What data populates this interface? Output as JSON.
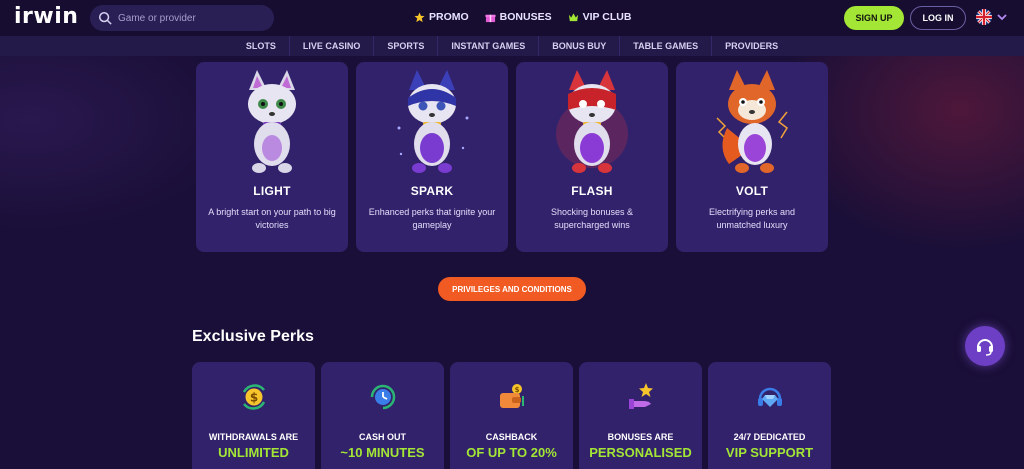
{
  "header": {
    "logo_text": "irwin",
    "search_placeholder": "Game or provider",
    "links": [
      {
        "label": "PROMO",
        "icon": "star-icon"
      },
      {
        "label": "BONUSES",
        "icon": "gift-icon"
      },
      {
        "label": "VIP CLUB",
        "icon": "crown-icon"
      }
    ],
    "signup_label": "SIGN UP",
    "login_label": "LOG IN",
    "language_icon": "uk-flag-icon"
  },
  "categories": [
    "SLOTS",
    "LIVE CASINO",
    "SPORTS",
    "INSTANT GAMES",
    "BONUS BUY",
    "TABLE GAMES",
    "PROVIDERS"
  ],
  "levels": [
    {
      "name": "LIGHT",
      "desc": "A bright start on your path to big victories",
      "color": "#d9d6e8"
    },
    {
      "name": "SPARK",
      "desc": "Enhanced perks that ignite your gameplay",
      "color": "#3b3fb8"
    },
    {
      "name": "FLASH",
      "desc": "Shocking bonuses & supercharged wins",
      "color": "#d8343b"
    },
    {
      "name": "VOLT",
      "desc": "Electrifying perks and unmatched luxury",
      "color": "#e0662a"
    }
  ],
  "privileges_label": "PRIVILEGES AND CONDITIONS",
  "perks_title": "Exclusive Perks",
  "perks": [
    {
      "l1": "WITHDRAWALS ARE",
      "l2": "UNLIMITED",
      "icon": "dollar-coin-icon"
    },
    {
      "l1": "CASH OUT",
      "l2": "~10 MINUTES",
      "icon": "clock-icon"
    },
    {
      "l1": "CASHBACK",
      "l2": "OF UP TO 20%",
      "icon": "wallet-icon"
    },
    {
      "l1": "BONUSES ARE",
      "l2": "PERSONALISED",
      "icon": "hand-star-icon"
    },
    {
      "l1": "24/7 DEDICATED",
      "l2": "VIP SUPPORT",
      "icon": "headset-diamond-icon"
    }
  ],
  "colors": {
    "accent_green": "#a3e635",
    "accent_orange": "#f15a22",
    "card_bg": "#32226b",
    "bg": "#1a0f38"
  }
}
